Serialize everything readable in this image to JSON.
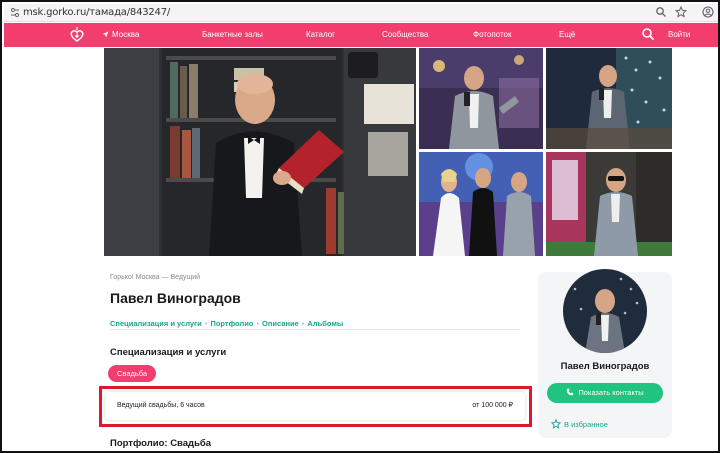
{
  "browser": {
    "url": "msk.gorko.ru/тамада/843247/",
    "icons": [
      "tune-icon",
      "zoom-icon",
      "bookmark-star-icon",
      "account-icon"
    ]
  },
  "nav": {
    "city": "Москва",
    "items": [
      {
        "label": "Банкетные залы"
      },
      {
        "label": "Каталог"
      },
      {
        "label": "Сообщества"
      },
      {
        "label": "Фотопоток"
      },
      {
        "label": "Ещё"
      }
    ],
    "login": "Войти",
    "brand_color": "#f23d6e"
  },
  "profile": {
    "breadcrumb": "Горько! Москва — Ведущий",
    "name": "Павел Виноградов",
    "anchors": [
      {
        "label": "Специализация и услуги"
      },
      {
        "label": "Портфолио"
      },
      {
        "label": "Описание"
      },
      {
        "label": "Альбомы"
      }
    ],
    "specialization_title": "Специализация и услуги",
    "tag": "Свадьба",
    "service": {
      "name": "Ведущий свадьбы, 6 часов",
      "price": "от 100 000 ₽"
    },
    "portfolio_title": "Портфолио: Свадьба"
  },
  "side": {
    "name": "Павел Виноградов",
    "contacts_button": "Показать контакты",
    "favorite": "В избранное",
    "accent_green": "#20c37f",
    "link_color": "#17a589"
  },
  "annotation_color": "#e0162b"
}
